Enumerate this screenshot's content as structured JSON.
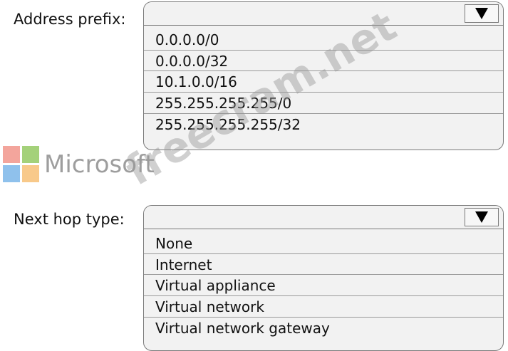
{
  "address_prefix": {
    "label": "Address prefix:",
    "selected_value": "",
    "options": [
      "0.0.0.0/0",
      "0.0.0.0/32",
      "10.1.0.0/16",
      "255.255.255.255/0",
      "255.255.255.255/32"
    ]
  },
  "next_hop_type": {
    "label": "Next hop type:",
    "selected_value": "",
    "options": [
      "None",
      "Internet",
      "Virtual appliance",
      "Virtual network",
      "Virtual network gateway"
    ]
  },
  "logo": {
    "wordmark": "Microsoft",
    "colors": [
      "#f3a59c",
      "#a4d17a",
      "#8fc1ec",
      "#f8c98a"
    ]
  },
  "watermark": {
    "text": "freecram.net"
  },
  "icons": {
    "dropdown_arrow": "triangle-down-icon"
  }
}
